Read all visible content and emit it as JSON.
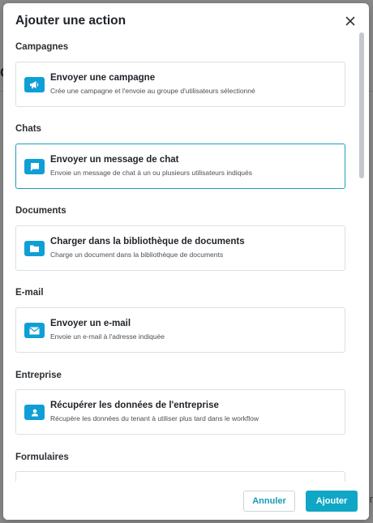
{
  "background": {
    "letter": "C",
    "right_text": "r"
  },
  "modal": {
    "title": "Ajouter une action",
    "close_icon": "close-icon"
  },
  "sections": [
    {
      "title": "Campagnes",
      "card": {
        "icon": "megaphone-icon",
        "title": "Envoyer une campagne",
        "description": "Crée une campagne et l'envoie au groupe d'utilisateurs sélectionné",
        "selected": false
      }
    },
    {
      "title": "Chats",
      "card": {
        "icon": "chat-bubble-icon",
        "title": "Envoyer un message de chat",
        "description": "Envoie un message de chat à un ou plusieurs utilisateurs indiqués",
        "selected": true
      }
    },
    {
      "title": "Documents",
      "card": {
        "icon": "folder-icon",
        "title": "Charger dans la bibliothèque de documents",
        "description": "Charge un document dans la bibliothèque de documents",
        "selected": false
      }
    },
    {
      "title": "E-mail",
      "card": {
        "icon": "envelope-icon",
        "title": "Envoyer un e-mail",
        "description": "Envoie un e-mail à l'adresse indiquée",
        "selected": false
      }
    },
    {
      "title": "Entreprise",
      "card": {
        "icon": "person-badge-icon",
        "title": "Récupérer les données de l'entreprise",
        "description": "Récupère les données du tenant à utiliser plus tard dans le workflow",
        "selected": false
      }
    },
    {
      "title": "Formulaires",
      "card": {
        "icon": "",
        "title": "",
        "description": "",
        "selected": false
      }
    }
  ],
  "footer": {
    "cancel_label": "Annuler",
    "add_label": "Ajouter"
  },
  "colors": {
    "accent": "#10a7c6",
    "icon_blue": "#0f9fd6",
    "selected_border": "#1aa0be"
  }
}
